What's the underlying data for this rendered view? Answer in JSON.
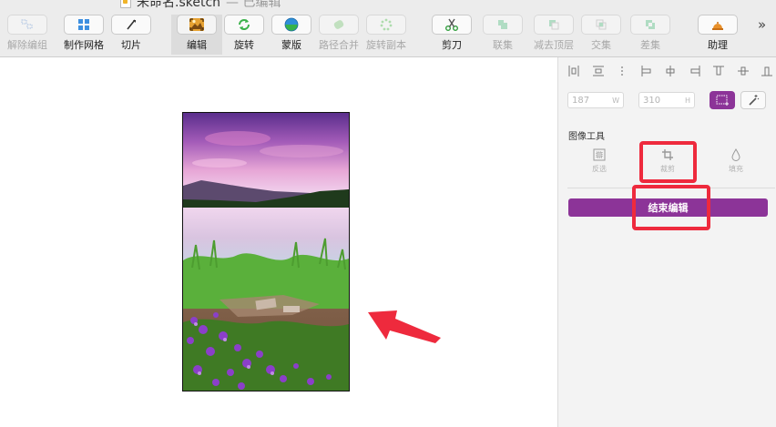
{
  "window": {
    "title": "未命名.sketch",
    "status": "— 已编辑"
  },
  "toolbar": {
    "items": [
      {
        "label": "解除编组",
        "icon": "ungroup-icon",
        "enabled": false
      },
      {
        "label": "制作网格",
        "icon": "make-grid-icon",
        "enabled": true
      },
      {
        "label": "切片",
        "icon": "slice-icon",
        "enabled": true
      },
      {
        "label": "编辑",
        "icon": "edit-image-icon",
        "enabled": true,
        "selected": true
      },
      {
        "label": "旋转",
        "icon": "rotate-icon",
        "enabled": true
      },
      {
        "label": "蒙版",
        "icon": "mask-icon",
        "enabled": true
      },
      {
        "label": "路径合并",
        "icon": "combine-path-icon",
        "enabled": false
      },
      {
        "label": "旋转副本",
        "icon": "rotate-copies-icon",
        "enabled": false
      },
      {
        "label": "剪刀",
        "icon": "scissors-icon",
        "enabled": true
      },
      {
        "label": "联集",
        "icon": "union-icon",
        "enabled": false
      },
      {
        "label": "减去顶层",
        "icon": "subtract-icon",
        "enabled": false
      },
      {
        "label": "交集",
        "icon": "intersect-icon",
        "enabled": false
      },
      {
        "label": "差集",
        "icon": "difference-icon",
        "enabled": false
      },
      {
        "label": "助理",
        "icon": "assistant-bell-icon",
        "enabled": true
      }
    ],
    "overflow": "»"
  },
  "inspector": {
    "width_value": "187",
    "width_unit": "W",
    "height_value": "310",
    "height_unit": "H",
    "section_title": "图像工具",
    "image_tools": [
      {
        "label": "反选",
        "icon": "invert-selection-icon"
      },
      {
        "label": "裁剪",
        "icon": "crop-icon"
      },
      {
        "label": "填充",
        "icon": "fill-drop-icon"
      }
    ],
    "finish_button": "结束编辑"
  },
  "colors": {
    "accent": "#8c3498",
    "highlight": "#ee2a3d",
    "toolbar_bg": "#ececec",
    "inspector_bg": "#f3f3f3"
  }
}
